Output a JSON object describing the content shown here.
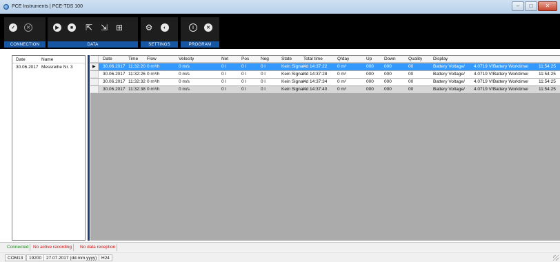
{
  "window": {
    "title": "PCE Instruments | PCE-TDS 100",
    "minimize": "–",
    "maximize": "□",
    "close": "✕"
  },
  "toolbar": {
    "groups": [
      {
        "label": "CONNECTION",
        "icons": [
          "check-icon",
          "close-icon"
        ]
      },
      {
        "label": "DATA",
        "icons": [
          "play-icon",
          "stop-icon",
          "export-icon",
          "import-icon",
          "shelf-icon"
        ]
      },
      {
        "label": "SETTINGS",
        "icons": [
          "gear-icon",
          "globe-icon"
        ]
      },
      {
        "label": "PROGRAM",
        "icons": [
          "info-icon",
          "exit-icon"
        ]
      }
    ]
  },
  "series_list": {
    "headers": {
      "date": "Date",
      "name": "Name"
    },
    "rows": [
      {
        "date": "30.06.2017",
        "name": "Messreihe Nr. 3"
      }
    ]
  },
  "grid": {
    "headers": {
      "date": "Date",
      "time": "Time",
      "flow": "Flow",
      "velocity": "Velocity",
      "net": "Net",
      "pos": "Pos",
      "neg": "Neg",
      "state": "State",
      "total_time": "Total time",
      "q_day": "Q/day",
      "up": "Up",
      "down": "Down",
      "quality": "Quality",
      "display": "Display"
    },
    "rows": [
      {
        "date": "30.06.2017",
        "time": "11:32:20",
        "flow": "0 m³/h",
        "velocity": "0 m/s",
        "net": "0 l",
        "pos": "0 l",
        "neg": "0 l",
        "state": "Kein Signal",
        "total_time": "4d 14:37:22",
        "q_day": "0 m³",
        "up": "000",
        "down": "000",
        "quality": "00",
        "display1": "Battery Voltage/",
        "display2": "4.0719 V/Battery Worktime/",
        "display3": "11:54:25"
      },
      {
        "date": "30.06.2017",
        "time": "11:32:26",
        "flow": "0 m³/h",
        "velocity": "0 m/s",
        "net": "0 l",
        "pos": "0 l",
        "neg": "0 l",
        "state": "Kein Signal",
        "total_time": "4d 14:37:28",
        "q_day": "0 m³",
        "up": "000",
        "down": "000",
        "quality": "00",
        "display1": "Battery Voltage/",
        "display2": "4.0719 V/Battery Worktime/",
        "display3": "11:54:25"
      },
      {
        "date": "30.06.2017",
        "time": "11:32:32",
        "flow": "0 m³/h",
        "velocity": "0 m/s",
        "net": "0 l",
        "pos": "0 l",
        "neg": "0 l",
        "state": "Kein Signal",
        "total_time": "4d 14:37:34",
        "q_day": "0 m³",
        "up": "000",
        "down": "000",
        "quality": "00",
        "display1": "Battery Voltage/",
        "display2": "4.0719 V/Battery Worktime/",
        "display3": "11:54:25"
      },
      {
        "date": "30.06.2017",
        "time": "11:32:38",
        "flow": "0 m³/h",
        "velocity": "0 m/s",
        "net": "0 l",
        "pos": "0 l",
        "neg": "0 l",
        "state": "Kein Signal",
        "total_time": "4d 14:37:40",
        "q_day": "0 m³",
        "up": "000",
        "down": "000",
        "quality": "00",
        "display1": "Battery Voltage/",
        "display2": "4.0719 V/Battery Worktime/",
        "display3": "11:54:25"
      }
    ]
  },
  "status": {
    "connected": "Connected",
    "recording": "No active recording",
    "reception": "No data reception"
  },
  "info": {
    "port": "COM13",
    "baud": "19200",
    "date_format": "27.07.2017 (dd.mm.yyyy)",
    "clock": "H24"
  },
  "colors": {
    "accent": "#1756a3",
    "selection": "#3399ff",
    "ok": "#1a8a1a",
    "warn": "#d01010"
  }
}
